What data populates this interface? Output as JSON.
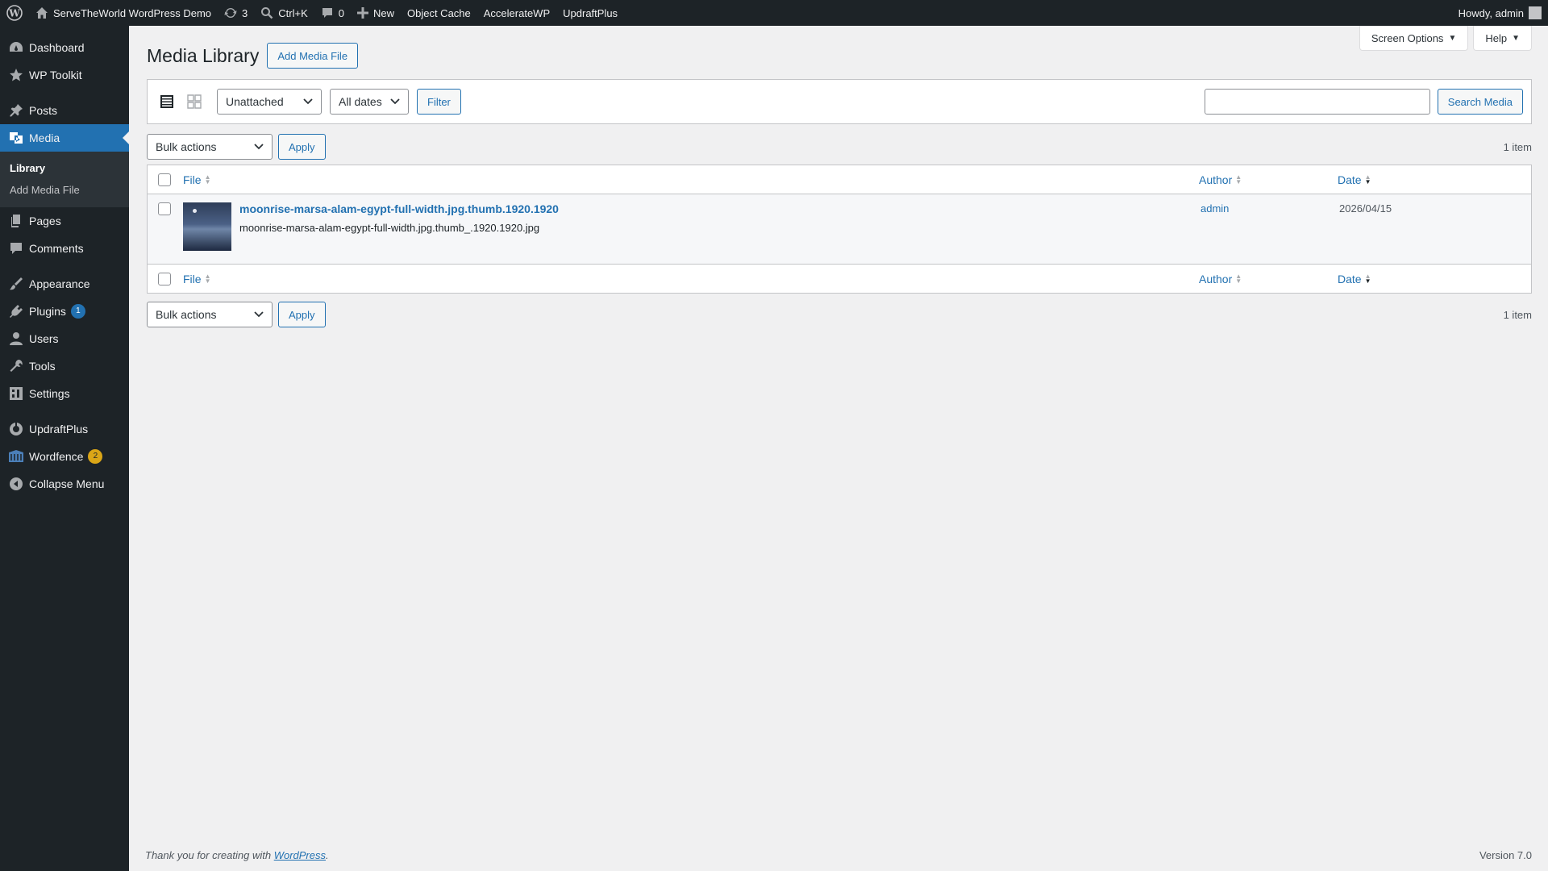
{
  "colors": {
    "adminbar_bg": "#1d2327",
    "accent": "#2271b1",
    "badge_orange": "#dba617"
  },
  "adminbar": {
    "site_name": "ServeTheWorld WordPress Demo",
    "updates_count": "3",
    "search_shortcut": "Ctrl+K",
    "comments_count": "0",
    "new_label": "New",
    "object_cache": "Object Cache",
    "accelerate": "AccelerateWP",
    "updraft": "UpdraftPlus",
    "greeting": "Howdy, admin"
  },
  "sidebar": {
    "dashboard": "Dashboard",
    "toolkit": "WP Toolkit",
    "posts": "Posts",
    "media": "Media",
    "library": "Library",
    "add_media_file": "Add Media File",
    "pages": "Pages",
    "comments": "Comments",
    "appearance": "Appearance",
    "plugins": "Plugins",
    "plugins_badge": "1",
    "users": "Users",
    "tools": "Tools",
    "settings": "Settings",
    "updraftplus": "UpdraftPlus",
    "wordfence": "Wordfence",
    "wordfence_badge": "2",
    "collapse": "Collapse Menu"
  },
  "screen_meta": {
    "screen_options": "Screen Options",
    "help": "Help"
  },
  "page": {
    "title": "Media Library",
    "add_button": "Add Media File"
  },
  "filters": {
    "attachment_filter": "Unattached",
    "date_filter": "All dates",
    "filter_button": "Filter",
    "search_value": "",
    "search_button": "Search Media"
  },
  "tablenav": {
    "bulk_actions": "Bulk actions",
    "apply": "Apply",
    "count": "1 item"
  },
  "table": {
    "columns": {
      "file": "File",
      "author": "Author",
      "date": "Date"
    },
    "rows": [
      {
        "title": "moonrise-marsa-alam-egypt-full-width.jpg.thumb.1920.1920",
        "filename": "moonrise-marsa-alam-egypt-full-width.jpg.thumb_.1920.1920.jpg",
        "author": "admin",
        "date": "2026/04/15"
      }
    ]
  },
  "footer": {
    "thanks_prefix": "Thank you for creating with ",
    "wordpress_link": "WordPress",
    "thanks_suffix": ".",
    "version": "Version 7.0"
  }
}
